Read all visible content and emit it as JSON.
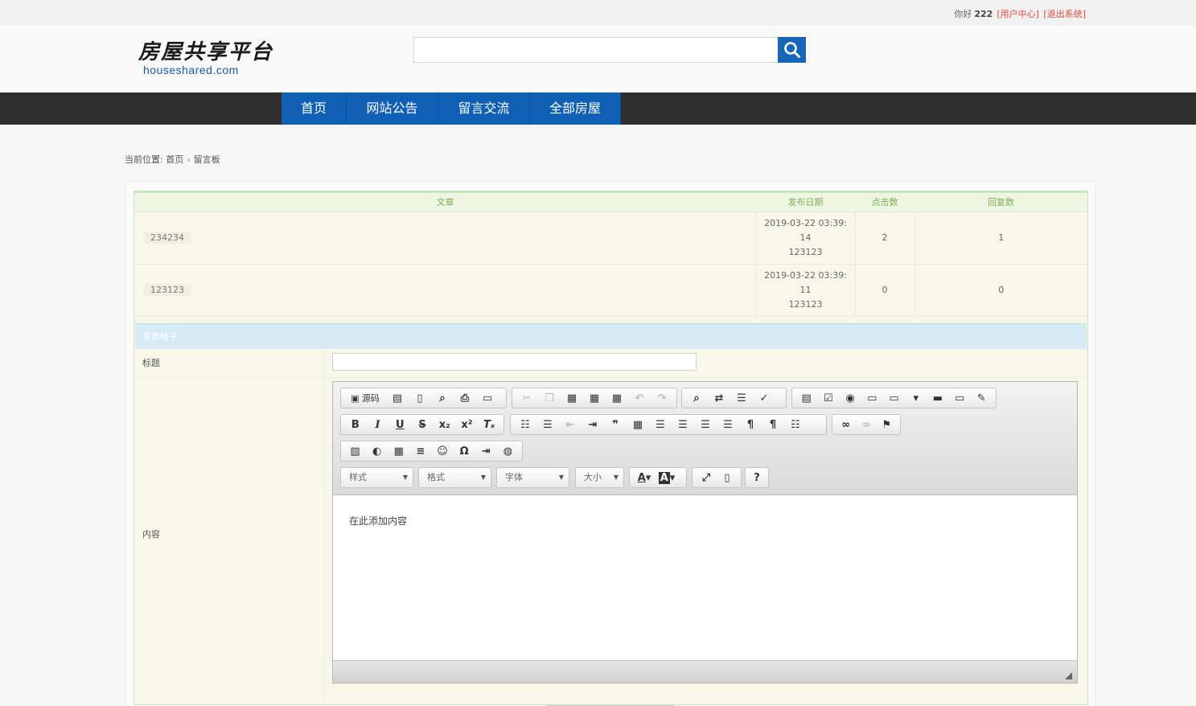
{
  "topbar": {
    "greeting": "你好",
    "username": "222",
    "user_center": "[用户中心]",
    "logout": "[退出系统]"
  },
  "logo": {
    "cn": "房屋共享平台",
    "en": "houseshared.com"
  },
  "search": {
    "placeholder": "",
    "icon": "search-icon"
  },
  "nav": {
    "items": [
      "首页",
      "网站公告",
      "留言交流",
      "全部房屋"
    ]
  },
  "breadcrumb": {
    "label": "当前位置:",
    "home": "首页",
    "current": "留言板"
  },
  "posts_table": {
    "headers": [
      "文章",
      "发布日期",
      "点击数",
      "回复数"
    ],
    "rows": [
      {
        "title": "234234",
        "date_line1": "2019-03-22 03:39:",
        "date_line2": "14",
        "author": "123123",
        "clicks": "2",
        "replies": "1"
      },
      {
        "title": "123123",
        "date_line1": "2019-03-22 03:39:",
        "date_line2": "11",
        "author": "123123",
        "clicks": "0",
        "replies": "0"
      }
    ]
  },
  "form": {
    "heading": "发表帖子",
    "title_label": "标题",
    "title_value": "",
    "content_label": "内容",
    "content_value": "在此添加内容"
  },
  "editor": {
    "source_label": "源码",
    "selects": {
      "style": "样式",
      "format": "格式",
      "font": "字体",
      "size": "大小"
    },
    "help_label": "?"
  }
}
